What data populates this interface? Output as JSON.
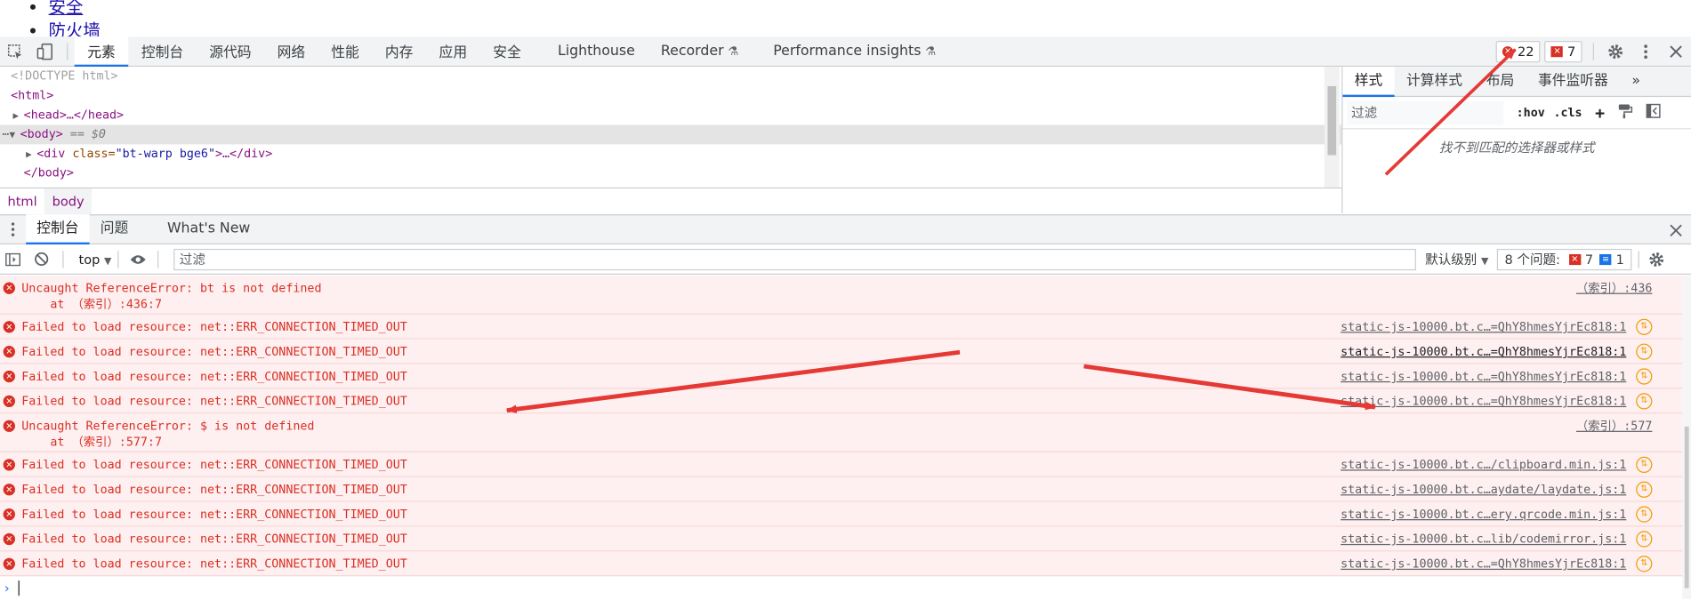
{
  "page": {
    "links": [
      "安全",
      "防火墙"
    ]
  },
  "toolbar": {
    "tabs": [
      "元素",
      "控制台",
      "源代码",
      "网络",
      "性能",
      "内存",
      "应用",
      "安全",
      "Lighthouse",
      "Recorder",
      "Performance insights"
    ],
    "error_count": "22",
    "issue_count": "7"
  },
  "elements": {
    "doctype": "<!DOCTYPE html>",
    "html_open": "<html>",
    "head": "<head>…</head>",
    "body_open": "<body>",
    "body_marker": "== $0",
    "div_open": "<div ",
    "div_attr_name": "class=",
    "div_attr_value": "\"bt-warp bge6\"",
    "div_close": ">…</div>",
    "body_close": "</body>",
    "breadcrumb": [
      "html",
      "body"
    ]
  },
  "styles": {
    "tabs": [
      "样式",
      "计算样式",
      "布局",
      "事件监听器"
    ],
    "more": "»",
    "filter_placeholder": "过滤",
    "hov": ":hov",
    "cls": ".cls",
    "plus": "+",
    "empty_message": "找不到匹配的选择器或样式"
  },
  "drawer": {
    "tabs": [
      "控制台",
      "问题",
      "What's New"
    ]
  },
  "console_toolbar": {
    "context": "top",
    "filter_placeholder": "过滤",
    "levels": "默认级别",
    "issues_label": "8 个问题:",
    "issues_errors": "7",
    "issues_info": "1"
  },
  "messages": [
    {
      "text": "Uncaught ReferenceError: bt is not defined",
      "stack": "    at （索引）:436:7",
      "source": "（索引）:436"
    },
    {
      "text": "Failed to load resource: net::ERR_CONNECTION_TIMED_OUT",
      "source": "static-js-10000.bt.c…=QhY8hmesYjrEc818:1"
    },
    {
      "text": "Failed to load resource: net::ERR_CONNECTION_TIMED_OUT",
      "source": "static-js-10000.bt.c…=QhY8hmesYjrEc818:1"
    },
    {
      "text": "Failed to load resource: net::ERR_CONNECTION_TIMED_OUT",
      "source": "static-js-10000.bt.c…=QhY8hmesYjrEc818:1"
    },
    {
      "text": "Failed to load resource: net::ERR_CONNECTION_TIMED_OUT",
      "source": "static-js-10000.bt.c…=QhY8hmesYjrEc818:1"
    },
    {
      "text": "Uncaught ReferenceError: $ is not defined",
      "stack": "    at （索引）:577:7",
      "source": "（索引）:577"
    },
    {
      "text": "Failed to load resource: net::ERR_CONNECTION_TIMED_OUT",
      "source": "static-js-10000.bt.c…/clipboard.min.js:1"
    },
    {
      "text": "Failed to load resource: net::ERR_CONNECTION_TIMED_OUT",
      "source": "static-js-10000.bt.c…aydate/laydate.js:1"
    },
    {
      "text": "Failed to load resource: net::ERR_CONNECTION_TIMED_OUT",
      "source": "static-js-10000.bt.c…ery.qrcode.min.js:1"
    },
    {
      "text": "Failed to load resource: net::ERR_CONNECTION_TIMED_OUT",
      "source": "static-js-10000.bt.c…lib/codemirror.js:1"
    },
    {
      "text": "Failed to load resource: net::ERR_CONNECTION_TIMED_OUT",
      "source": "static-js-10000.bt.c…=QhY8hmesYjrEc818:1"
    }
  ],
  "colors": {
    "accent": "#1a73e8",
    "error": "#d93025",
    "error_bg": "#fef0f0",
    "annotation": "#e53935"
  }
}
